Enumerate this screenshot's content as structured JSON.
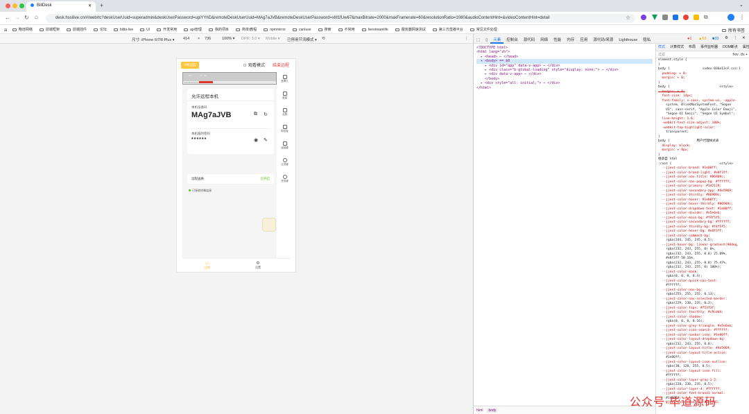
{
  "browser": {
    "tab_title": "BillDesk",
    "new_tab": "+",
    "url": "desk.hssilive.cn/#/webrtc?deskUserUuid=superadmin&deskUserPassword=upiYYhD&remoteDeskUserUuid=MAg7aJVB&remoteDeskUserPassword=xM1fUw67&maxBitrate=2000&maxFramerate=60&resolutionRatio=1080&audioContentHint=&videoContentHint=detail",
    "bookmarks": [
      "略培网络",
      "前端框架",
      "前端插件",
      "论坛",
      "bilibi-live",
      "UI",
      "开发常用",
      "api管理",
      "我的项目",
      "简单/教程",
      "npmmirror",
      "canIuse",
      "搜索",
      "不常用",
      "livestreamlife",
      "服务器网速测试",
      "第三方直播平台",
      "常见文件处理"
    ],
    "all_bookmarks": "所有书签"
  },
  "device_toolbar": {
    "size_label": "尺寸: iPhone 6/7/8 Plus ▾",
    "width": "414",
    "x": "×",
    "height": "736",
    "zoom": "100% ▾",
    "dpr": "DPR: 3.0 ▾",
    "mode": "Mobile ▾",
    "throttle": "已停用节流模式 ▾"
  },
  "phone": {
    "badge": "手机远程",
    "view_mode": "观看模式",
    "end_remote": "结束远程",
    "panel_title": "允许远程本机",
    "device_code_label": "本机设备码",
    "device_code": "MAg7aJVB",
    "password_label": "本机临时密码",
    "password": "******",
    "quality_label": "远程画质",
    "quality_value": "已开启",
    "status": "已接收终端连接",
    "sidebar": [
      "投屏ㄦ",
      "音量",
      "全屏",
      "剪切板",
      "返回键",
      "主页键",
      "任务键"
    ],
    "nav": [
      "远程",
      "设置"
    ]
  },
  "devtools": {
    "tabs": [
      "元素",
      "控制台",
      "源代码",
      "网络",
      "性能",
      "内存",
      "应用",
      "源代码/来源",
      "Lighthouse",
      "隐私"
    ],
    "errors": "1",
    "warnings": "63",
    "info": "33",
    "html_lines": [
      "<!DOCTYPE html>",
      "<html lang=\"zh\">",
      "  ▸ <head> ⋯ </head>",
      "  ▾ <body> == $0",
      "    ▸ <div id=\"app\" data-v-app> ⋯ </div>",
      "    ▸ <div class=\"b-global-loading\" style=\"display: none;\"> ⋯ </div>",
      "    ▸ <div data-v-app> ⋯ </div>",
      "    </body>",
      "  ▸ <div style=\"all: initial;\"> ⋯ </div>",
      "</html>"
    ],
    "crumbs": [
      "html",
      "body"
    ],
    "style_tabs": [
      "样式",
      "计算样式",
      "布局",
      "事件监听器",
      "DOM断点",
      "属性"
    ],
    "filter": "过滤",
    "rules": [
      "element.style {",
      "}",
      "body {                 index-036e13cF.css:1",
      "  padding: ▸ 0;",
      "  margin: ▸ 0;",
      "}",
      "body {                          <style>",
      "  margin: ▸ 0;",
      "  font-size: 14px;",
      "  font-family: v-sans, system-ui, -apple-",
      "    system, BlinkMacSystemFont, \"Segoe",
      "    UI\", sans-serif, \"Apple Color Emoji\",",
      "    \"Segoe UI Emoji\", \"Segoe UI Symbol\";",
      "  line-height: 1.6;",
      "  -webkit-text-size-adjust: 100%;",
      "  -webkit-tap-highlight-color:",
      "    transparent;",
      "}",
      "body {              用户代理样式表",
      "  display: block;",
      "  margin: ▸ 8px;",
      "}",
      "继承自 html",
      ":root {                         <style>",
      "  --jjext-color-brand: #1e80ff;",
      "  --jjext-color-brand-light: #e8f3ff;",
      "  --jjext-color-nav-title: #86909c;",
      "  --jjext-color-nav-popup-bg: #ffffff;",
      "  --jjext-color-primary: #1d2129;",
      "  --jjext-color-secondary-app: #4e5969;",
      "  --jjext-color-thirdly: #86909c;",
      "  --jjext-color-hover: #1e80ff;",
      "  --jjext-color-hover-thirdly: #86909c;",
      "  --jjext-color-dropdown-text: #1e80ff;",
      "  --jjext-color-divider: #e5e6eb;",
      "  --jjext-color-main-bg: #f4f5f5;",
      "  --jjext-color-secondary-bg: #ffffff;",
      "  --jjext-color-thirdly-bg: #f4f5f5;",
      "  --jjext-color-hover-bg: #e8f3ff;",
      "  --jjext-color-comment-bg:",
      "    rgba(244, 245, 245, 0.5);",
      "  --jjext-hover-bg: linear-gradient(90deg,",
      "    rgba(232, 243, 255, 0) 0%,",
      "    rgba(232, 243, 255, 0.8) 25.09%,",
      "    #e8f3ff 50.16%,",
      "    rgba(232, 243, 255, 0.8) 75.47%,",
      "    rgba(232, 243, 255, 0) 100%);",
      "  --jjext-color-mask:",
      "    rgba(0, 0, 0, 0.4);",
      "  --jjext-color-quick-nav-text:",
      "    #ffffff;",
      "  --jjext-color-nav-bg:",
      "    rgba(255, 255, 255, 0.13);",
      "  --jjext-color-nav-selected-border:",
      "    rgba(229, 230, 235, 0.3);",
      "  --jjext-color-tips: #f53f3f;",
      "  --jjext-color-fourthly: #c9cdd4;",
      "  --jjext-color-shadow:",
      "    rgba(0, 0, 0, 0.16);",
      "  --jjext-color-grey-triangle: #e5e6eb;",
      "  --jjext-color-icon-search: #ffffff;",
      "  --jjext-color-navbar-icon: #1e80ff;",
      "  --jjext-color-layout-dropdown-bg:",
      "    rgba(232, 243, 255, 0.8);",
      "  --jjext-color-layout-title: #4e5969;",
      "  --jjext-color-layout-title-active:",
      "    #1e80ff;",
      "  --jjext-color-layout-icon-outline:",
      "    rgba(30, 128, 255, 0.5);",
      "  --jjext-color-layout-icon-fill:",
      "    #ffffff;",
      "  --jjext-color-layer-gray-1-2:",
      "    rgba(228, 230, 235, 0.5);",
      "  --jjext-color-layer-4: #ffffff;",
      "  --jjext-color-font-brand1-normal:",
      "    #1e80ff;",
      "  --jjext-color-font-1: #252933;"
    ]
  },
  "watermark": "公众号·毕道源码",
  "colors": {
    "accent": "#1a73e8",
    "danger": "#e0332e",
    "badge": "#ffc53d",
    "ok": "#52c41a"
  }
}
